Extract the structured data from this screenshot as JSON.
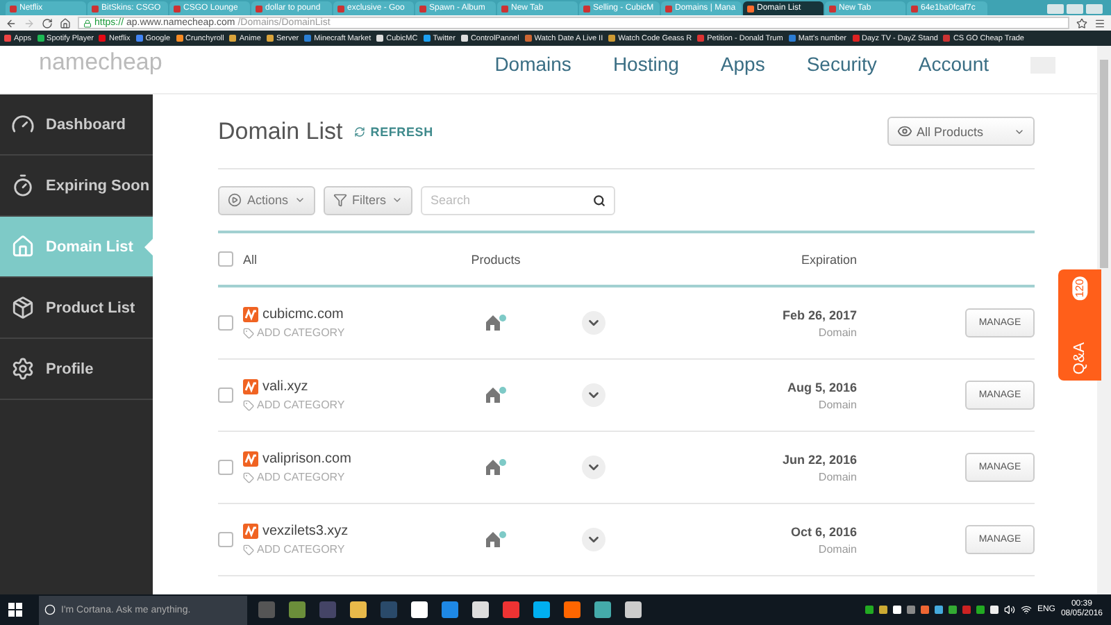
{
  "browser": {
    "tabs": [
      {
        "title": "Netflix",
        "selected": false
      },
      {
        "title": "BitSkins: CSGO",
        "selected": false
      },
      {
        "title": "CSGO Lounge",
        "selected": false
      },
      {
        "title": "dollar to pound",
        "selected": false
      },
      {
        "title": "exclusive - Goo",
        "selected": false
      },
      {
        "title": "Spawn - Album",
        "selected": false
      },
      {
        "title": "New Tab",
        "selected": false
      },
      {
        "title": "Selling - CubicM",
        "selected": false
      },
      {
        "title": "Domains | Mana",
        "selected": false
      },
      {
        "title": "Domain List",
        "selected": true
      },
      {
        "title": "New Tab",
        "selected": false
      },
      {
        "title": "64e1ba0fcaf7c",
        "selected": false
      }
    ],
    "url_secure": "https://",
    "url_host": "ap.www.namecheap.com",
    "url_path": "/Domains/DomainList",
    "bookmarks": [
      "Apps",
      "Spotify Player",
      "Netflix",
      "Google",
      "Crunchyroll",
      "Anime",
      "Server",
      "Minecraft Market",
      "CubicMC",
      "Twitter",
      "ControlPannel",
      "Watch Date A Live II",
      "Watch Code Geass R",
      "Petition - Donald Trum",
      "Matt's number",
      "Dayz TV - DayZ Stand",
      "CS GO Cheap Trade"
    ]
  },
  "header": {
    "logo": "namecheap",
    "nav": [
      "Domains",
      "Hosting",
      "Apps",
      "Security",
      "Account"
    ]
  },
  "sidebar": {
    "items": [
      {
        "label": "Dashboard",
        "kind": "gauge",
        "selected": false
      },
      {
        "label": "Expiring Soon",
        "kind": "timer",
        "selected": false
      },
      {
        "label": "Domain List",
        "kind": "home",
        "selected": true
      },
      {
        "label": "Product List",
        "kind": "box",
        "selected": false
      },
      {
        "label": "Profile",
        "kind": "gear",
        "selected": false
      }
    ]
  },
  "main": {
    "title": "Domain List",
    "refresh": "REFRESH",
    "view_select": "All Products",
    "actions": "Actions",
    "filters": "Filters",
    "search": {
      "placeholder": "Search"
    },
    "table": {
      "select_all": {
        "label": "All",
        "checked": false
      },
      "columns": [
        "Products",
        "Expiration"
      ],
      "rows": [
        {
          "domain": "cubicmc.com",
          "category": "ADD CATEGORY",
          "expiration": "Feb 26, 2017",
          "type": "Domain",
          "action": "MANAGE",
          "checked": false
        },
        {
          "domain": "vali.xyz",
          "category": "ADD CATEGORY",
          "expiration": "Aug 5, 2016",
          "type": "Domain",
          "action": "MANAGE",
          "checked": false
        },
        {
          "domain": "valiprison.com",
          "category": "ADD CATEGORY",
          "expiration": "Jun 22, 2016",
          "type": "Domain",
          "action": "MANAGE",
          "checked": false
        },
        {
          "domain": "vexzilets3.xyz",
          "category": "ADD CATEGORY",
          "expiration": "Oct 6, 2016",
          "type": "Domain",
          "action": "MANAGE",
          "checked": false
        }
      ]
    }
  },
  "qa_tab": {
    "label": "Q&A",
    "count": "120"
  },
  "taskbar": {
    "search_placeholder": "I'm Cortana. Ask me anything.",
    "language": "ENG",
    "time": "00:39",
    "date": "08/05/2016"
  }
}
